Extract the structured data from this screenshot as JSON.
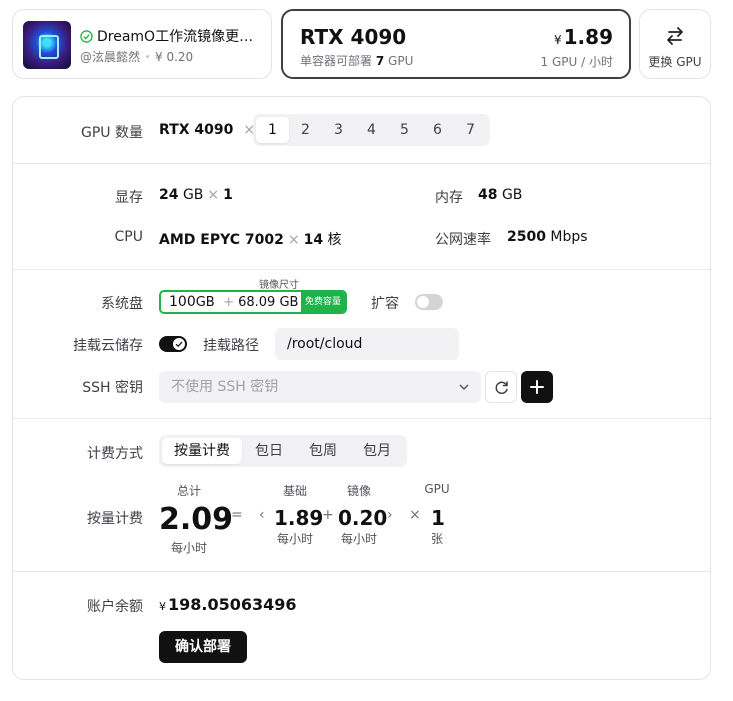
{
  "image_card": {
    "title": "DreamO工作流镜像更新...",
    "author": "@泫晨懿然",
    "price": "¥ 0.20"
  },
  "gpu_card": {
    "name": "RTX 4090",
    "sub_prefix": "单容器可部署",
    "sub_count": "7",
    "sub_suffix": "GPU",
    "currency": "¥",
    "price": "1.89",
    "unit": "1 GPU / 小时"
  },
  "swap_card": {
    "label": "更换 GPU"
  },
  "gpu_count": {
    "label": "GPU 数量",
    "gpu_name": "RTX 4090",
    "times": "×",
    "options": [
      "1",
      "2",
      "3",
      "4",
      "5",
      "6",
      "7"
    ],
    "selected": "1"
  },
  "specs": {
    "vram_label": "显存",
    "vram_value": "24",
    "vram_unit": "GB",
    "vram_times": "×",
    "vram_count": "1",
    "ram_label": "内存",
    "ram_value": "48",
    "ram_unit": "GB",
    "cpu_label": "CPU",
    "cpu_value": "AMD EPYC 7002",
    "cpu_times": "×",
    "cpu_cores": "14",
    "cpu_unit": "核",
    "net_label": "公网速率",
    "net_value": "2500",
    "net_unit": "Mbps"
  },
  "storage": {
    "system_disk_label": "系统盘",
    "disk_base": "100",
    "disk_unit": "GB",
    "plus": "+",
    "image_size": "68.09 GB",
    "image_size_caption": "镜像尺寸",
    "free_tag": "免费容量",
    "expand_label": "扩容",
    "expand_on": false,
    "cloud_label": "挂载云储存",
    "cloud_on": true,
    "mount_path_label": "挂载路径",
    "mount_path": "/root/cloud",
    "ssh_label": "SSH 密钥",
    "ssh_placeholder": "不使用 SSH 密钥"
  },
  "billing": {
    "method_label": "计费方式",
    "methods": [
      "按量计费",
      "包日",
      "包周",
      "包月"
    ],
    "selected_method": "按量计费",
    "payg_label": "按量计费",
    "total_caption": "总计",
    "total_value": "2.09",
    "total_unit": "每小时",
    "eq": "=",
    "base_caption": "基础",
    "base_value": "1.89",
    "base_unit": "每小时",
    "plus": "+",
    "image_caption": "镜像",
    "image_value": "0.20",
    "image_unit": "每小时",
    "times": "×",
    "gpu_caption": "GPU",
    "gpu_value": "1",
    "gpu_unit": "张",
    "lt": "‹",
    "gt": "›"
  },
  "account": {
    "balance_label": "账户余额",
    "currency": "¥",
    "balance": "198.05063496",
    "confirm_label": "确认部署"
  },
  "colors": {
    "accent_green": "#1fb34a",
    "dark": "#111111",
    "border": "#e4e4e7"
  }
}
